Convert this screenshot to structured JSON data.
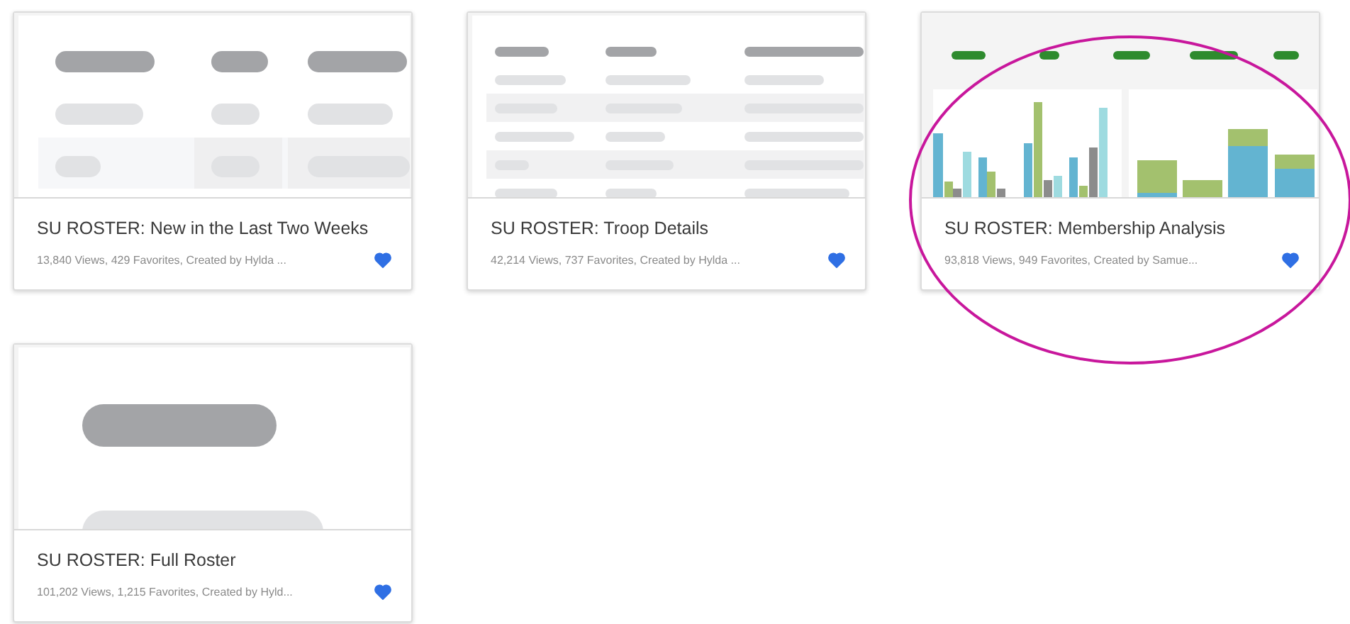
{
  "cards": [
    {
      "kind": "table",
      "title": "SU ROSTER: New in the Last Two Weeks",
      "meta": "13,840 Views, 429 Favorites, Created by Hylda ...",
      "favorite": true,
      "circled": false
    },
    {
      "kind": "dense-table",
      "title": "SU ROSTER: Troop Details",
      "meta": "42,214 Views, 737 Favorites, Created by Hylda ...",
      "favorite": true,
      "circled": false
    },
    {
      "kind": "charts",
      "title": "SU ROSTER: Membership Analysis",
      "meta": "93,818 Views, 949 Favorites, Created by Samue...",
      "favorite": true,
      "circled": true
    },
    {
      "kind": "pill",
      "title": "SU ROSTER: Full Roster",
      "meta": "101,202 Views, 1,215 Favorites, Created by Hyld...",
      "favorite": true,
      "circled": false
    }
  ]
}
